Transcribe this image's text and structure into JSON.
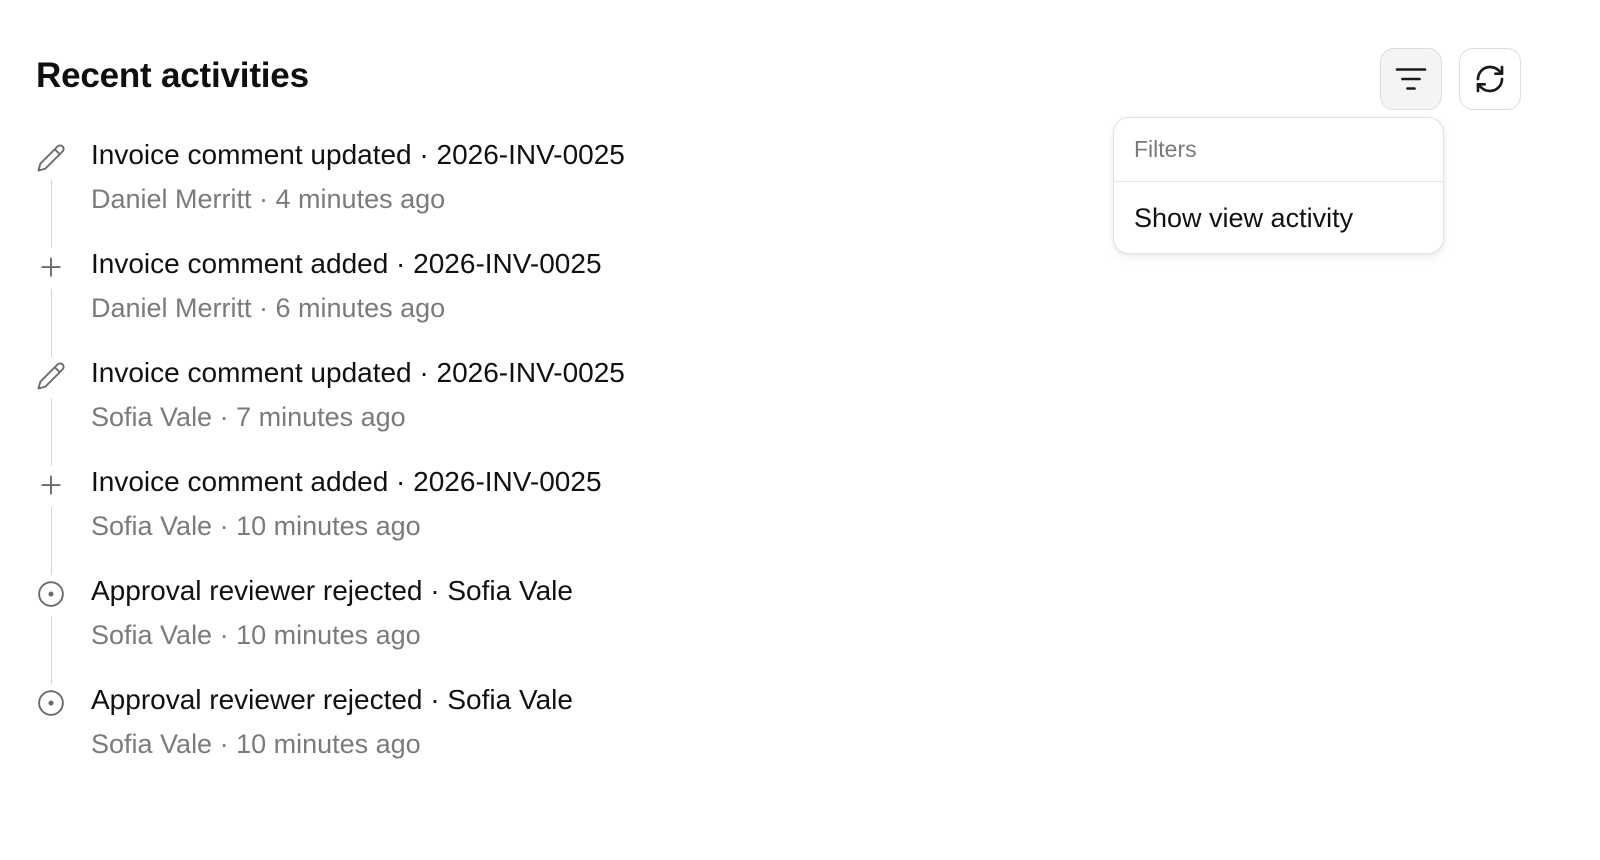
{
  "header": {
    "title": "Recent activities",
    "filter_icon": "filter-lines-icon",
    "refresh_icon": "refresh-icon"
  },
  "filters_menu": {
    "header": "Filters",
    "items": [
      {
        "label": "Show view activity"
      }
    ]
  },
  "activities": [
    {
      "icon": "pencil-icon",
      "title": "Invoice comment updated · 2026-INV-0025",
      "meta": "Daniel Merritt · 4 minutes ago"
    },
    {
      "icon": "plus-icon",
      "title": "Invoice comment added · 2026-INV-0025",
      "meta": "Daniel Merritt · 6 minutes ago"
    },
    {
      "icon": "pencil-icon",
      "title": "Invoice comment updated · 2026-INV-0025",
      "meta": "Sofia Vale · 7 minutes ago"
    },
    {
      "icon": "plus-icon",
      "title": "Invoice comment added · 2026-INV-0025",
      "meta": "Sofia Vale · 10 minutes ago"
    },
    {
      "icon": "circle-dot-icon",
      "title": "Approval reviewer rejected · Sofia Vale",
      "meta": "Sofia Vale · 10 minutes ago"
    },
    {
      "icon": "circle-dot-icon",
      "title": "Approval reviewer rejected · Sofia Vale",
      "meta": "Sofia Vale · 10 minutes ago"
    }
  ],
  "colors": {
    "text_primary": "#111111",
    "text_secondary": "#7b7b7b",
    "border": "#dedede",
    "connector": "#d7d7d7",
    "active_button_bg": "#f4f4f4"
  }
}
